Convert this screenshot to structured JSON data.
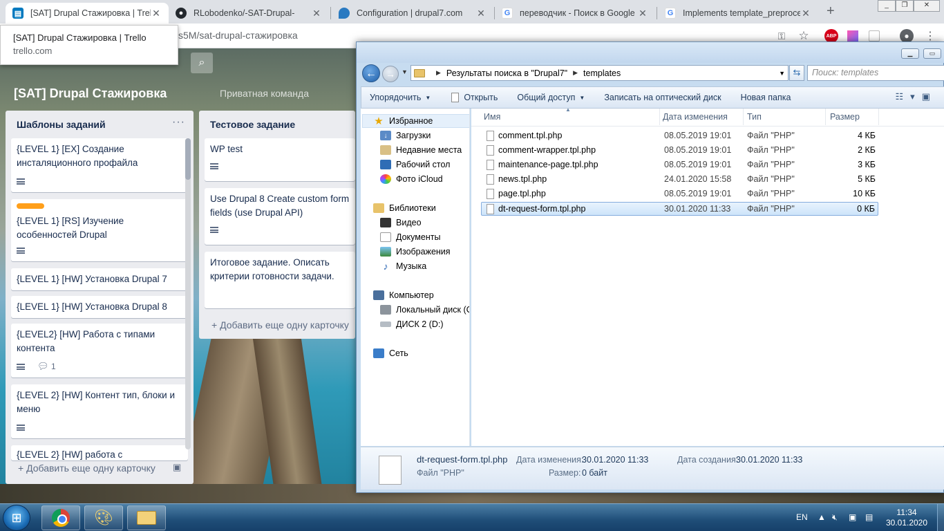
{
  "browser": {
    "tabs": [
      {
        "title": "[SAT] Drupal Стажировка | Trell",
        "favicon": "trello-icon",
        "active": true
      },
      {
        "title": "RLobodenko/-SAT-Drupal-",
        "favicon": "github-icon"
      },
      {
        "title": "Configuration | drupal7.com",
        "favicon": "drupal-icon"
      },
      {
        "title": "переводчик - Поиск в Google",
        "favicon": "google-icon"
      },
      {
        "title": "Implements template_preproces",
        "favicon": "google-icon"
      }
    ],
    "tab_close": "✕",
    "new_tab": "+",
    "url": "s5M/sat-drupal-стажировка",
    "tooltip": {
      "title": "[SAT] Drupal Стажировка | Trello",
      "domain": "trello.com"
    },
    "extension_abp": "ABP"
  },
  "trello": {
    "board_title": "[SAT] Drupal Стажировка",
    "team_label": "Приватная команда",
    "lists": [
      {
        "title": "Шаблоны заданий",
        "more": "···",
        "cards": [
          {
            "text": "{LEVEL 1} [EX] Создание инсталяционного профайла"
          },
          {
            "text": "{LEVEL 1} [RS] Изучение особенностей Drupal"
          },
          {
            "text": "{LEVEL 1} [HW] Установка Drupal 7"
          },
          {
            "text": "{LEVEL 1} [HW] Установка Drupal 8"
          },
          {
            "text": "{LEVEL2} [HW] Работа с типами контента",
            "comments": "1"
          },
          {
            "text": "{LEVEL 2} [HW] Контент тип, блоки и меню"
          },
          {
            "text": "{LEVEL 2} [HW] работа с"
          }
        ],
        "add_card": "+ Добавить еще одну карточку"
      },
      {
        "title": "Тестовое задание",
        "cards": [
          {
            "text": "WP test"
          },
          {
            "text": "Use Drupal 8 Create custom form fields (use Drupal API)"
          },
          {
            "text": "Итоговое задание. Описать критерии готовности задачи."
          }
        ],
        "add_card": "+ Добавить еще одну карточку"
      }
    ]
  },
  "explorer": {
    "address": {
      "crumb1": "Результаты поиска в \"Drupal7\"",
      "crumb2": "templates"
    },
    "search_placeholder": "Поиск: templates",
    "commands": {
      "organize": "Упорядочить",
      "open": "Открыть",
      "share": "Общий доступ",
      "burn": "Записать на оптический диск",
      "new_folder": "Новая папка"
    },
    "nav": {
      "favorites": "Избранное",
      "downloads": "Загрузки",
      "recent": "Недавние места",
      "desktop": "Рабочий стол",
      "icloud": "Фото iCloud",
      "libraries": "Библиотеки",
      "video": "Видео",
      "documents": "Документы",
      "images": "Изображения",
      "music": "Музыка",
      "computer": "Компьютер",
      "local_disk": "Локальный диск (C",
      "disk2": "ДИСК 2 (D:)",
      "network": "Сеть"
    },
    "columns": {
      "name": "Имя",
      "date": "Дата изменения",
      "type": "Тип",
      "size": "Размер"
    },
    "files": [
      {
        "name": "comment.tpl.php",
        "date": "08.05.2019 19:01",
        "type": "Файл \"PHP\"",
        "size": "4 КБ"
      },
      {
        "name": "comment-wrapper.tpl.php",
        "date": "08.05.2019 19:01",
        "type": "Файл \"PHP\"",
        "size": "2 КБ"
      },
      {
        "name": "maintenance-page.tpl.php",
        "date": "08.05.2019 19:01",
        "type": "Файл \"PHP\"",
        "size": "3 КБ"
      },
      {
        "name": "news.tpl.php",
        "date": "24.01.2020 15:58",
        "type": "Файл \"PHP\"",
        "size": "5 КБ"
      },
      {
        "name": "page.tpl.php",
        "date": "08.05.2019 19:01",
        "type": "Файл \"PHP\"",
        "size": "10 КБ"
      },
      {
        "name": "dt-request-form.tpl.php",
        "date": "30.01.2020 11:33",
        "type": "Файл \"PHP\"",
        "size": "0 КБ",
        "selected": true
      }
    ],
    "details": {
      "name": "dt-request-form.tpl.php",
      "type": "Файл \"PHP\"",
      "modified_label": "Дата изменения:",
      "modified": "30.01.2020 11:33",
      "created_label": "Дата создания:",
      "created": "30.01.2020 11:33",
      "size_label": "Размер:",
      "size": "0 байт"
    }
  },
  "taskbar": {
    "lang": "EN",
    "time": "11:34",
    "date": "30.01.2020"
  }
}
